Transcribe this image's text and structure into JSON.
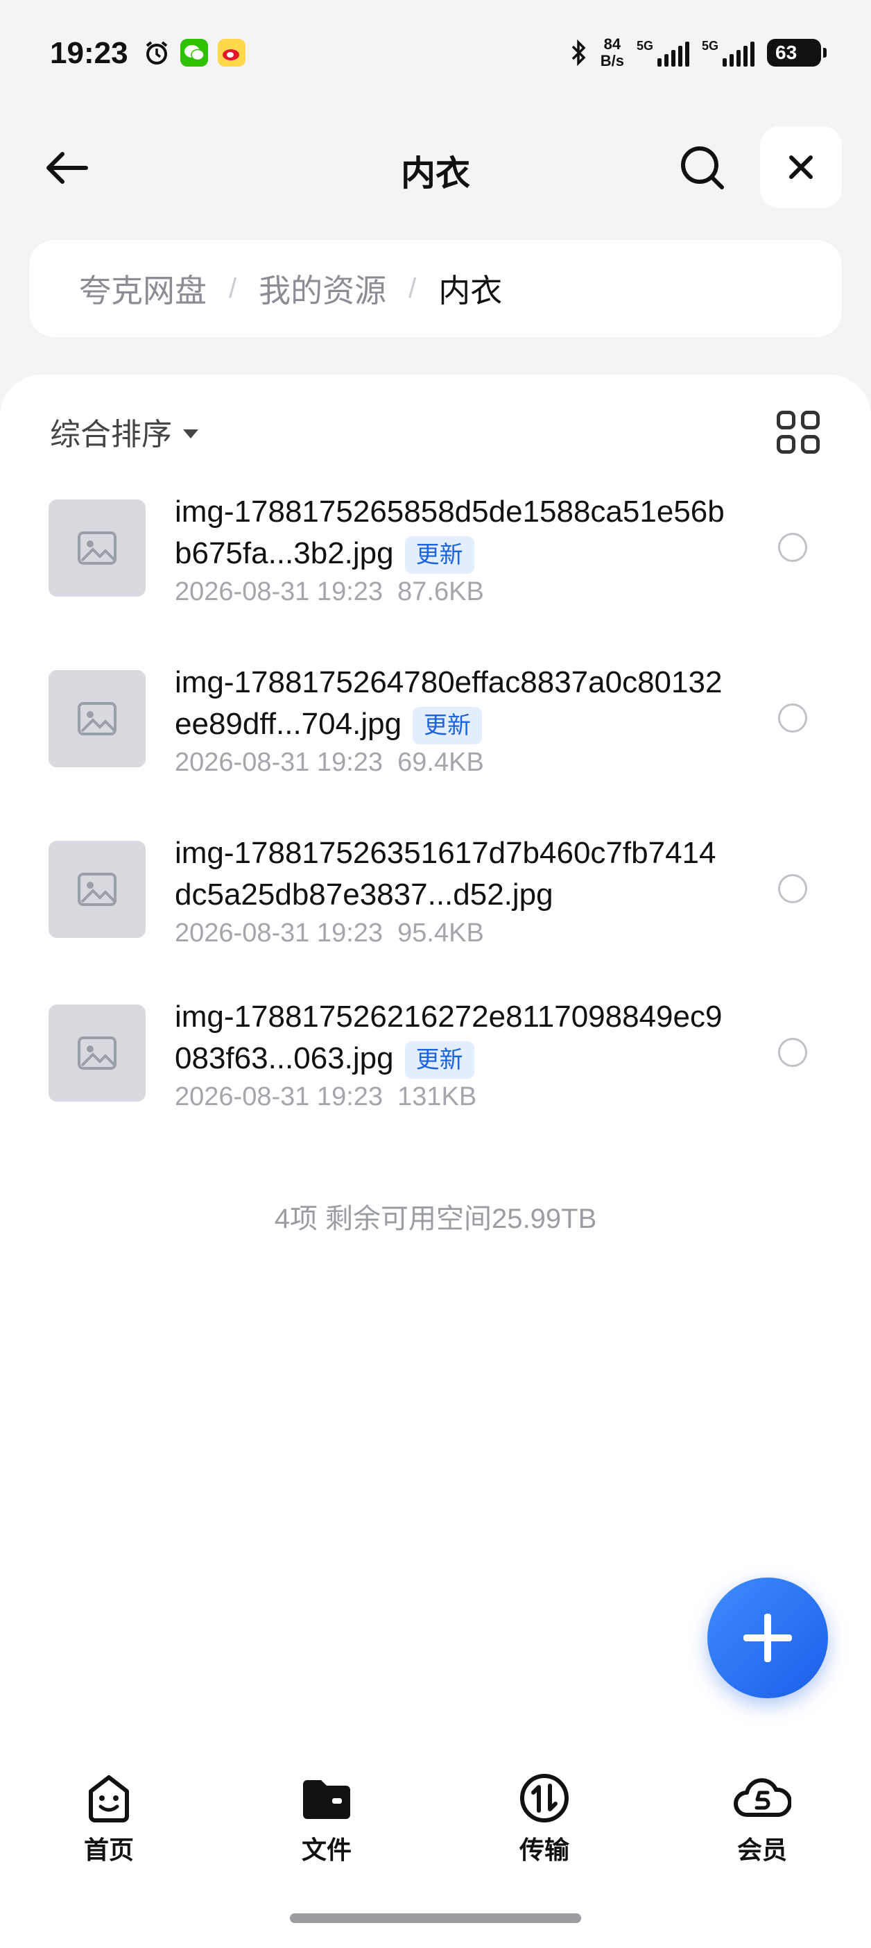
{
  "status_bar": {
    "time": "19:23",
    "net_speed_value": "84",
    "net_speed_unit": "B/s",
    "signal_1_label": "5G",
    "signal_2_label": "5G",
    "battery": "63"
  },
  "header": {
    "title": "内衣"
  },
  "breadcrumb": {
    "items": [
      "夸克网盘",
      "我的资源",
      "内衣"
    ],
    "separator": "/"
  },
  "toolbar": {
    "sort_label": "综合排序"
  },
  "files": [
    {
      "name": "img-1788175265858d5de1588ca51e56bb675fa...3b2.jpg",
      "badge": "更新",
      "date": "2026-08-31 19:23",
      "size": "87.6KB"
    },
    {
      "name": "img-1788175264780effac8837a0c80132ee89dff...704.jpg",
      "badge": "更新",
      "date": "2026-08-31 19:23",
      "size": "69.4KB"
    },
    {
      "name": "img-178817526351617d7b460c7fb7414dc5a25db87e3837...d52.jpg",
      "badge": "",
      "date": "2026-08-31 19:23",
      "size": "95.4KB"
    },
    {
      "name": "img-178817526216272e8117098849ec9083f63...063.jpg",
      "badge": "更新",
      "date": "2026-08-31 19:23",
      "size": "131KB"
    }
  ],
  "footer": {
    "summary": "4项 剩余可用空间25.99TB"
  },
  "bottom_nav": {
    "items": [
      {
        "label": "首页",
        "icon": "home-face-icon"
      },
      {
        "label": "文件",
        "icon": "folder-icon"
      },
      {
        "label": "传输",
        "icon": "transfer-icon"
      },
      {
        "label": "会员",
        "icon": "cloud-member-icon"
      }
    ]
  },
  "colors": {
    "accent": "#1c63e0",
    "badge_bg": "#e3eeff",
    "fab": "#2a73f5"
  }
}
